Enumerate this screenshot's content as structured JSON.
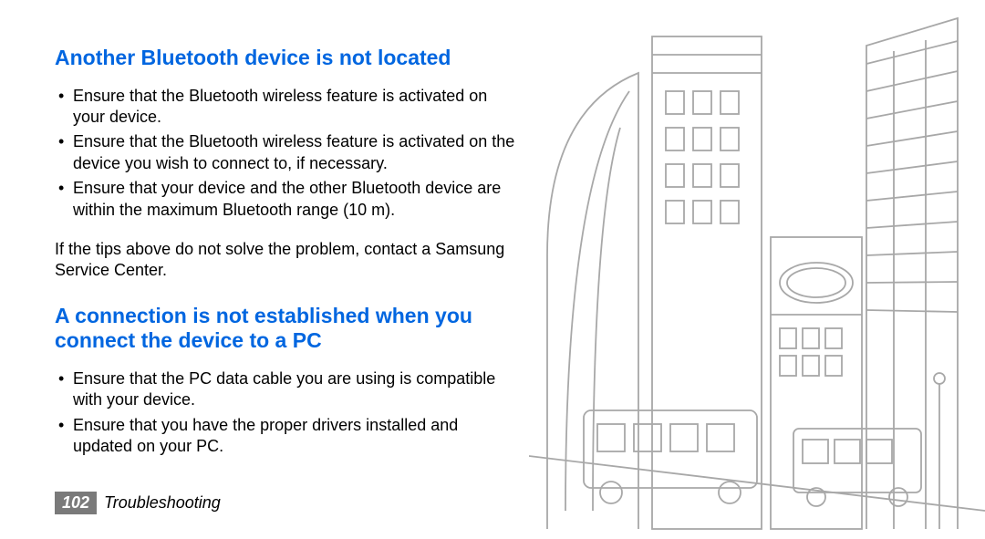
{
  "section1": {
    "heading": "Another Bluetooth device is not located",
    "bullets": [
      "Ensure that the Bluetooth wireless feature is activated on your device.",
      "Ensure that the Bluetooth wireless feature is activated on the device you wish to connect to, if necessary.",
      "Ensure that your device and the other Bluetooth device are within the maximum Bluetooth range (10 m)."
    ],
    "closing": "If the tips above do not solve the problem, contact a Samsung Service Center."
  },
  "section2": {
    "heading": "A connection is not established when you connect the device to a PC",
    "bullets": [
      "Ensure that the PC data cable you are using is compatible with your device.",
      "Ensure that you have the proper drivers installed and updated on your PC."
    ]
  },
  "footer": {
    "page_number": "102",
    "section_name": "Troubleshooting"
  }
}
